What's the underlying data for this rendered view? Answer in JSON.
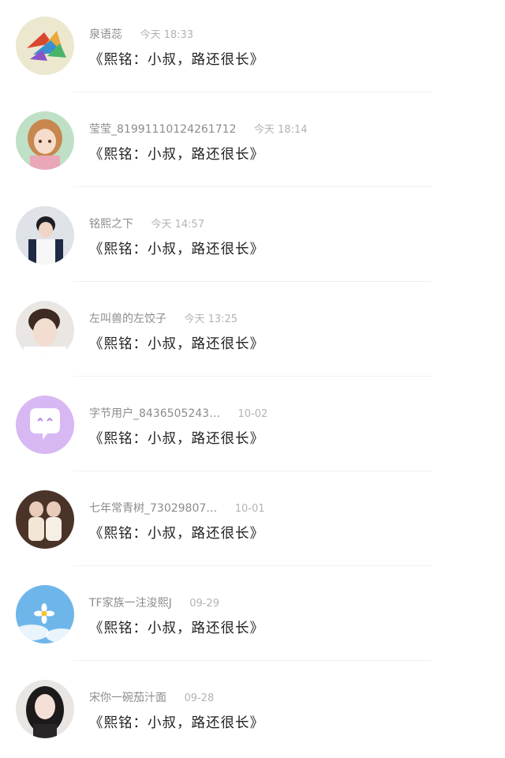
{
  "comments": [
    {
      "name": "泉语蕊",
      "time": "今天 18:33",
      "text": "《熙铭：小叔，路还很长》",
      "avatar_icon": "paper-crane-avatar-icon"
    },
    {
      "name": "莹莹_81991110124261712",
      "time": "今天 18:14",
      "text": "《熙铭：小叔，路还很长》",
      "avatar_icon": "anime-girl-avatar-icon"
    },
    {
      "name": "铭熙之下",
      "time": "今天 14:57",
      "text": "《熙铭：小叔，路还很长》",
      "avatar_icon": "boy-portrait-avatar-icon"
    },
    {
      "name": "左叫兽的左饺子",
      "time": "今天 13:25",
      "text": "《熙铭：小叔，路还很长》",
      "avatar_icon": "boy-face-avatar-icon"
    },
    {
      "name": "字节用户_8436505243…",
      "time": "10-02",
      "text": "《熙铭：小叔，路还很长》",
      "avatar_icon": "chat-bubble-avatar-icon"
    },
    {
      "name": "七年常青树_73029807…",
      "time": "10-01",
      "text": "《熙铭：小叔，路还很长》",
      "avatar_icon": "group-photo-avatar-icon"
    },
    {
      "name": "TF家族一注浚熙J",
      "time": "09-29",
      "text": "《熙铭：小叔，路还很长》",
      "avatar_icon": "flower-sky-avatar-icon"
    },
    {
      "name": "宋你一碗茄汁面",
      "time": "09-28",
      "text": "《熙铭：小叔，路还很长》",
      "avatar_icon": "girl-portrait-avatar-icon"
    }
  ],
  "colors": {
    "name": "#8c8c8c",
    "time": "#b3b3b3",
    "text": "#222222",
    "chat_avatar_bg": "#d7b8f3"
  }
}
